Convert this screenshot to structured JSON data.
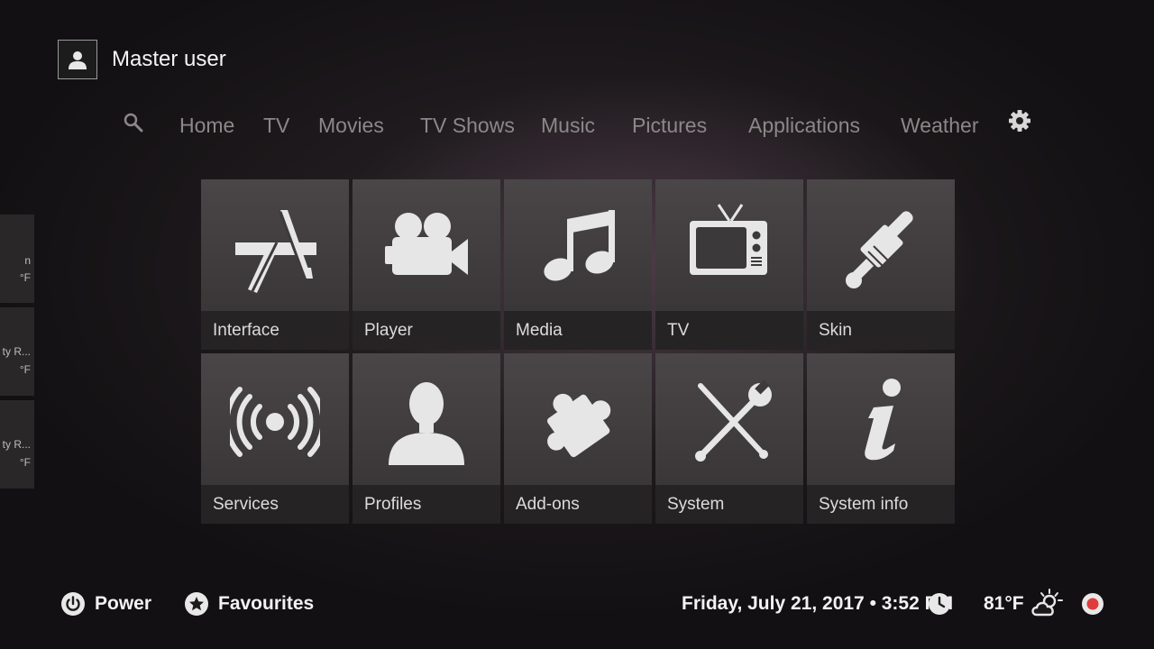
{
  "profile": {
    "name": "Master user",
    "icon": "user-icon"
  },
  "nav": {
    "search_icon": "search-icon",
    "items": [
      "Home",
      "TV",
      "Movies",
      "TV Shows",
      "Music",
      "Pictures",
      "Applications",
      "Weather"
    ],
    "settings_icon": "gear-icon"
  },
  "side_widgets": [
    {
      "line1": "n",
      "line2": "°F"
    },
    {
      "line1": "ty R...",
      "line2": "°F"
    },
    {
      "line1": "ty R...",
      "line2": "°F"
    }
  ],
  "tiles": [
    {
      "label": "Interface",
      "icon": "appstore-icon"
    },
    {
      "label": "Player",
      "icon": "movie-camera-icon"
    },
    {
      "label": "Media",
      "icon": "music-note-icon"
    },
    {
      "label": "TV",
      "icon": "television-icon"
    },
    {
      "label": "Skin",
      "icon": "paintbrush-icon"
    },
    {
      "label": "Services",
      "icon": "broadcast-icon"
    },
    {
      "label": "Profiles",
      "icon": "person-icon"
    },
    {
      "label": "Add-ons",
      "icon": "puzzle-icon"
    },
    {
      "label": "System",
      "icon": "tools-icon"
    },
    {
      "label": "System info",
      "icon": "info-icon"
    }
  ],
  "footer": {
    "power_label": "Power",
    "favourites_label": "Favourites",
    "datetime": "Friday, July 21, 2017 • 3:52 PM",
    "temperature": "81°F",
    "record_color": "#e03b3b"
  }
}
